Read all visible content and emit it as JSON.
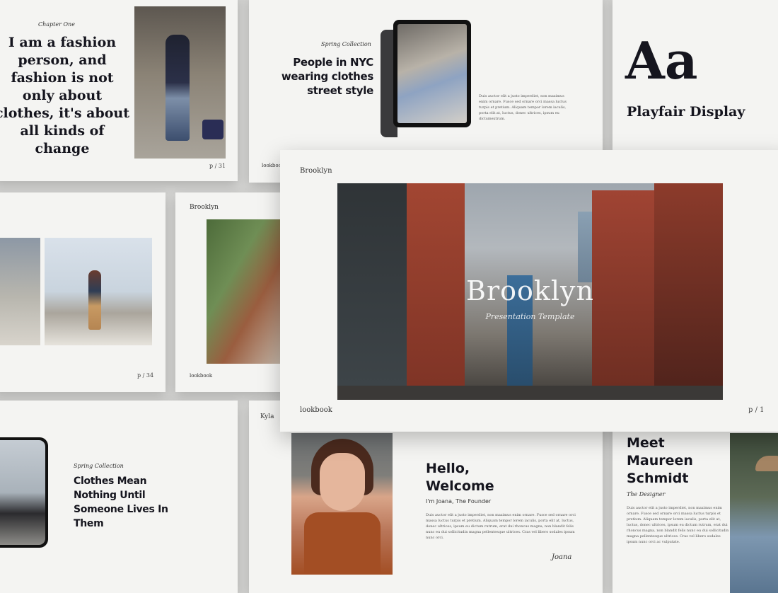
{
  "slide1": {
    "chapter": "Chapter One",
    "quote": "I am a fashion person, and fashion is not only about clothes, it's about all kinds of change",
    "page": "p / 31"
  },
  "slide2": {
    "collection": "Spring Collection",
    "title": "People in NYC wearing clothes street style",
    "body": "Duis auctor elit a justo imperdiet, non maximus enim ornare. Fusce sed ornare orci massa luctus turpis et pretium. Aliquam tempor lorem iaculis, porta elit at, luctus, donec ultrices, ipsum eu dictumextrum.",
    "footer": "lookbook"
  },
  "slide3": {
    "glyph": "Aa",
    "font_name": "Playfair Display"
  },
  "slide4": {
    "page": "p / 34"
  },
  "slide5": {
    "label": "Brooklyn",
    "footer": "lookbook"
  },
  "main": {
    "label": "Brooklyn",
    "title": "Brooklyn",
    "subtitle": "Presentation Template",
    "footer": "lookbook",
    "page": "p / 1"
  },
  "slide6": {
    "collection": "Spring Collection",
    "title": "Clothes Mean Nothing Until Someone Lives In Them"
  },
  "slide7": {
    "label": "Kyla",
    "title": "Hello, Welcome",
    "subtitle": "I'm Joana, The Founder",
    "body": "Duis auctor elit a justo imperdiet, non maximus enim ornare. Fusce sed ornare orci massa luctus turpis et pretium. Aliquam tempor lorem iaculis, porta elit at, luctus, donec ultrices, ipsum eu dictum rutrum, erat dui rhoncus magna, non blandit felis nunc eu dui sollicitudin magna pellentesque ultrices. Cras vel libero sodales ipsum nunc orci.",
    "signature": "Joana"
  },
  "slide8": {
    "title": "Meet Maureen Schmidt",
    "role": "The Designer",
    "body": "Duis auctor elit a justo imperdiet, non maximus enim ornare. Fusce sed ornare orci massa luctus turpis et pretium. Aliquam tempor lorem iaculis, porta elit at, luctus, donec ultrices, ipsum eu dictum rutrum, erat dui rhoncus magna, non blandit felis nunc eu dui sollicitudin magna pellentesque ultrices. Cras vel libero sodales ipsum nunc orci ac vulputate."
  }
}
